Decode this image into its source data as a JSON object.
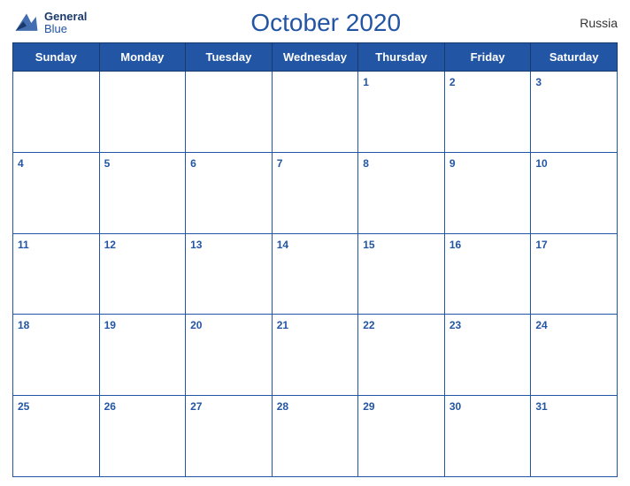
{
  "logo": {
    "line1": "General",
    "line2": "Blue"
  },
  "title": "October 2020",
  "country": "Russia",
  "days_of_week": [
    "Sunday",
    "Monday",
    "Tuesday",
    "Wednesday",
    "Thursday",
    "Friday",
    "Saturday"
  ],
  "weeks": [
    [
      null,
      null,
      null,
      null,
      1,
      2,
      3
    ],
    [
      4,
      5,
      6,
      7,
      8,
      9,
      10
    ],
    [
      11,
      12,
      13,
      14,
      15,
      16,
      17
    ],
    [
      18,
      19,
      20,
      21,
      22,
      23,
      24
    ],
    [
      25,
      26,
      27,
      28,
      29,
      30,
      31
    ]
  ]
}
